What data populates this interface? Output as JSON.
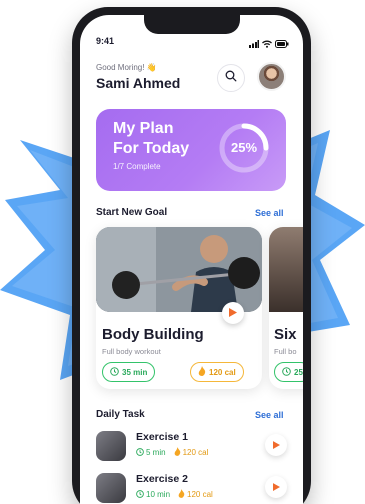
{
  "status": {
    "time": "9:41"
  },
  "header": {
    "greeting": "Good Moring! 👋",
    "user_name": "Sami Ahmed"
  },
  "plan": {
    "title_line1": "My Plan",
    "title_line2": "For Today",
    "subtitle": "1/7 Complete",
    "progress_label": "25%",
    "progress_fraction": 0.25
  },
  "goals_section": {
    "title": "Start New Goal",
    "see_all": "See all",
    "cards": [
      {
        "title": "Body Building",
        "subtitle": "Full body workout",
        "duration": "35 min",
        "calories": "120 cal"
      },
      {
        "title": "Six",
        "subtitle": "Full bo",
        "duration": "25"
      }
    ]
  },
  "tasks_section": {
    "title": "Daily Task",
    "see_all": "See all",
    "items": [
      {
        "name": "Exercise 1",
        "duration": "5 min",
        "calories": "120 cal"
      },
      {
        "name": "Exercise 2",
        "duration": "10 min",
        "calories": "120 cal"
      }
    ]
  },
  "colors": {
    "accent_purple": "#a56cf0",
    "link_blue": "#2f6fd6",
    "green": "#2aa95b",
    "orange": "#e39a14",
    "play_orange": "#f06b2c",
    "burst_blue": "#5aa6f5"
  }
}
